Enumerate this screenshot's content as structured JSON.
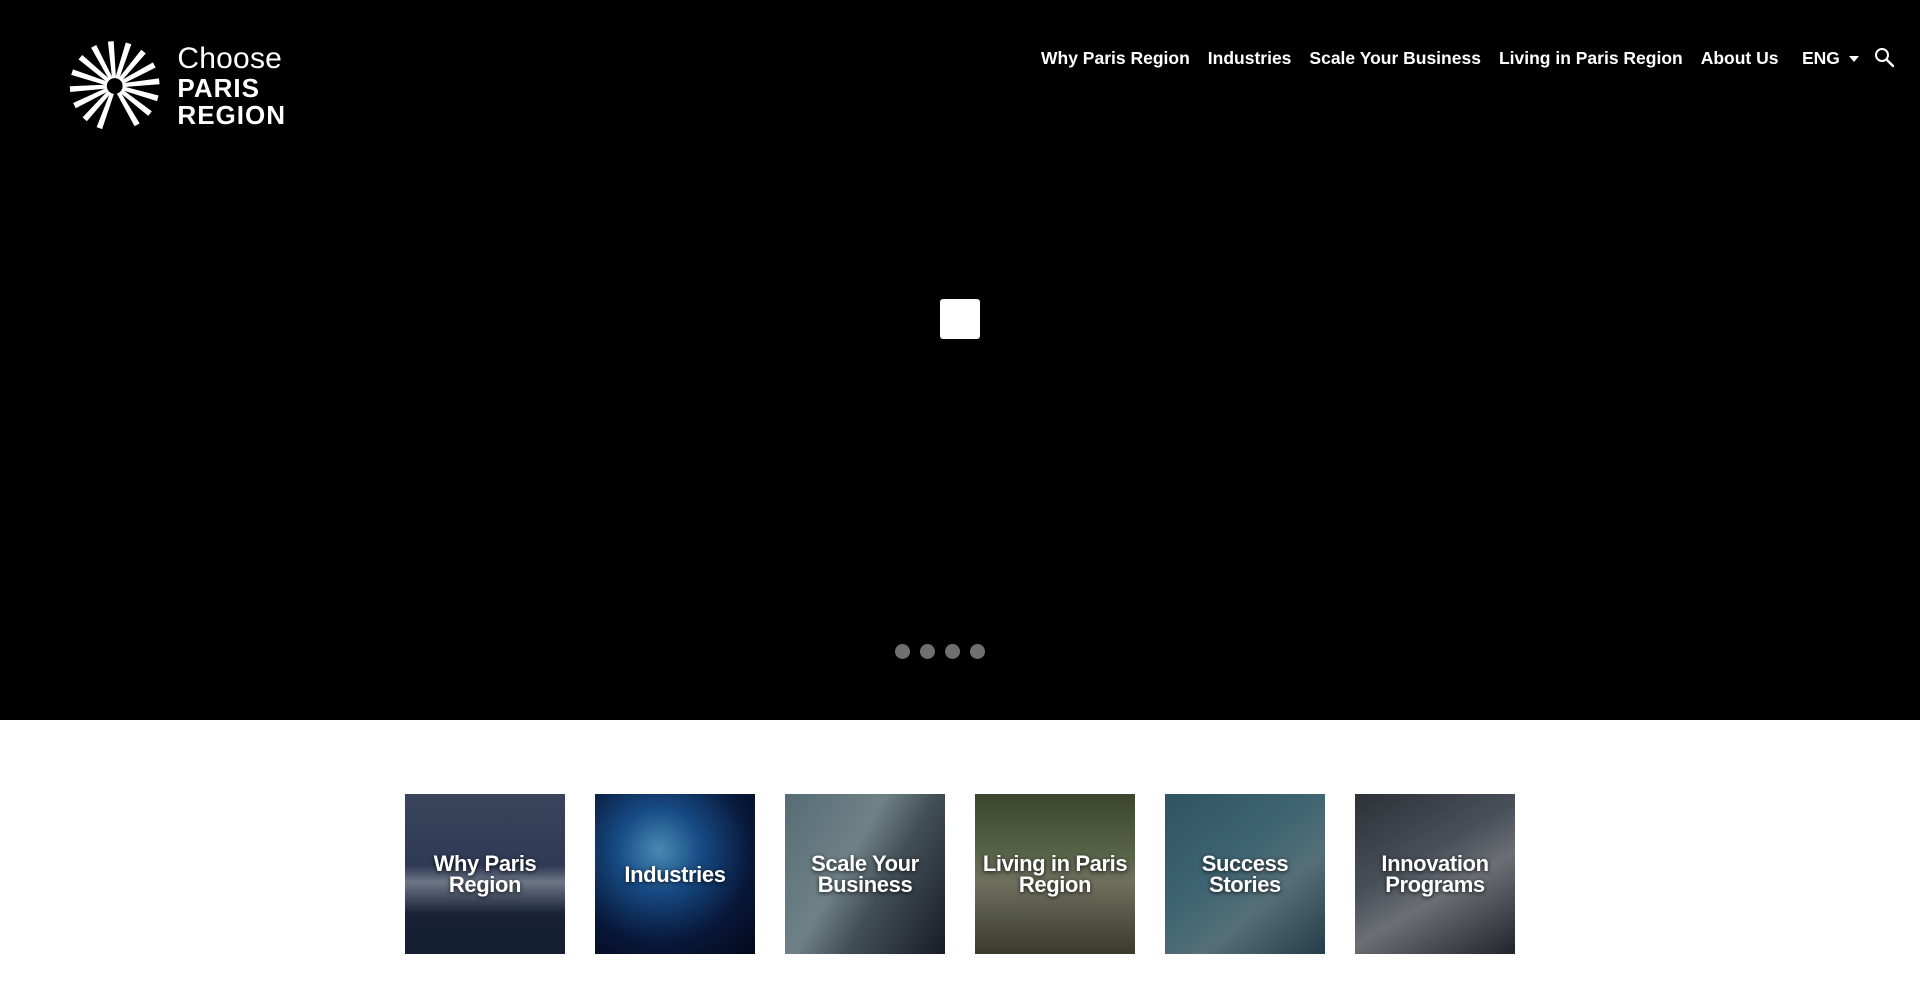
{
  "header": {
    "logo": {
      "line1": "Choose",
      "line2": "PARIS",
      "line3": "REGION"
    },
    "nav": [
      {
        "label": "Why Paris Region"
      },
      {
        "label": "Industries"
      },
      {
        "label": "Scale Your Business"
      },
      {
        "label": "Living in Paris Region"
      },
      {
        "label": "About Us"
      }
    ],
    "language": "ENG",
    "search_icon": "search-icon"
  },
  "hero": {
    "background_color": "#000000",
    "slider_dots_count": 4,
    "dot_color": "#6f6f6f"
  },
  "tiles": [
    {
      "label": "Why Paris Region"
    },
    {
      "label": "Industries"
    },
    {
      "label": "Scale Your Business"
    },
    {
      "label": "Living in Paris Region"
    },
    {
      "label": "Success Stories"
    },
    {
      "label": "Innovation Programs"
    }
  ]
}
